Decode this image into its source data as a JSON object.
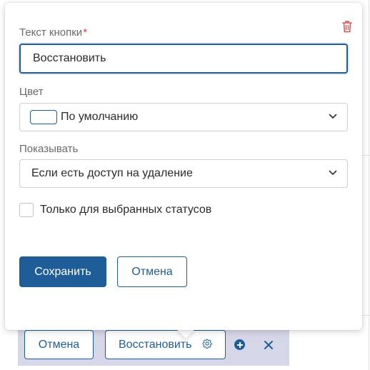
{
  "toolbar": {
    "cancel_label": "Отмена",
    "restore_label": "Восстановить",
    "settings_icon": "gear-icon",
    "add_icon": "plus-circle-icon",
    "remove_icon": "close-icon",
    "background_color": "#d7d7ea"
  },
  "popover": {
    "delete_icon": "trash-icon",
    "button_text": {
      "label": "Текст кнопки",
      "required_mark": "*",
      "value": "Восстановить"
    },
    "color": {
      "label": "Цвет",
      "selected": "По умолчанию"
    },
    "show": {
      "label": "Показывать",
      "selected": "Если есть доступ на удаление"
    },
    "only_selected_statuses": {
      "label": "Только для выбранных статусов",
      "checked": false
    },
    "save_label": "Сохранить",
    "cancel_label": "Отмена"
  },
  "colors": {
    "accent": "#1f5d99",
    "required": "#d33b3b",
    "danger_icon": "#d9534f"
  }
}
